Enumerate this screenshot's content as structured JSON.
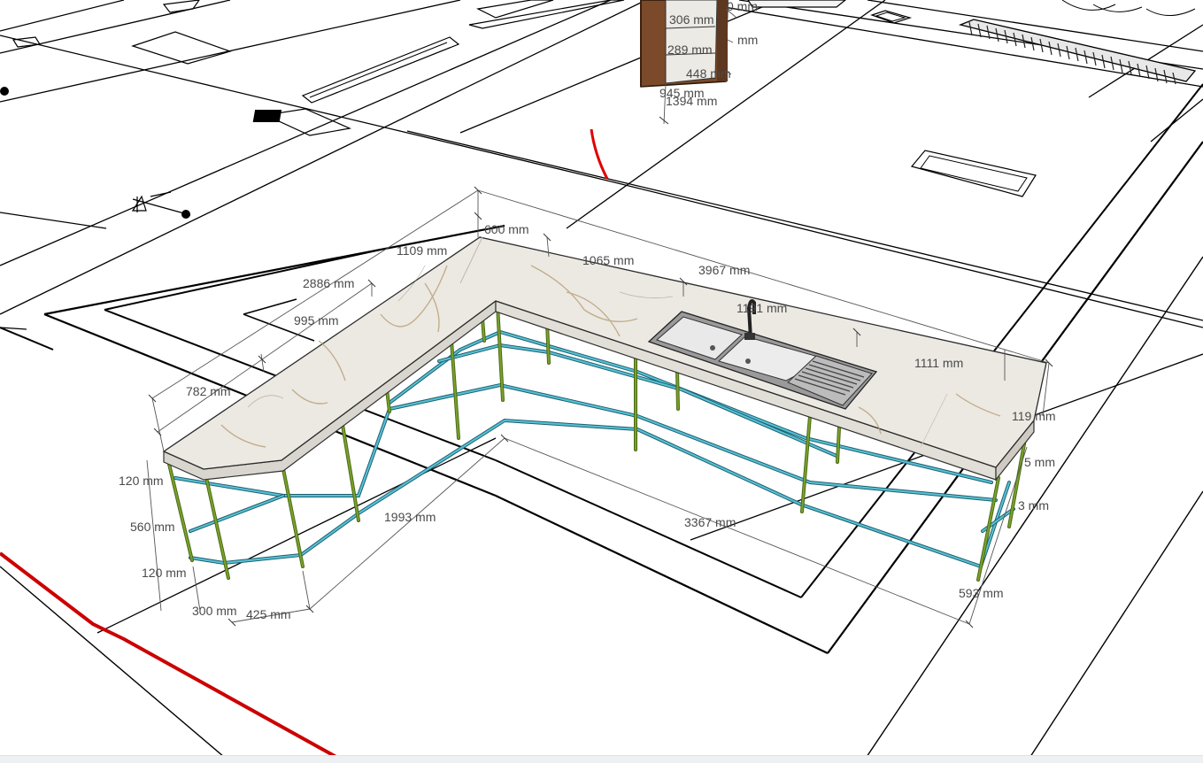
{
  "colors": {
    "background": "#ffffff",
    "plan_lines": "#000000",
    "red_axis": "#cc0000",
    "frame_green": "#4b6a16",
    "frame_cyan": "#56c2d6",
    "marble": "#ece9e3",
    "wood": "#7a4a2a"
  },
  "dimensions": {
    "d600": "600 mm",
    "d1109": "1109 mm",
    "d1065": "1065 mm",
    "d3967": "3967 mm",
    "d2886": "2886 mm",
    "d995": "995 mm",
    "d1191": "1191 mm",
    "d782": "782 mm",
    "d1111": "1111 mm",
    "d119": "119 mm",
    "d120a": "120 mm",
    "d560": "560 mm",
    "d120b": "120 mm",
    "d1993": "1993 mm",
    "d3367": "3367 mm",
    "d300": "300 mm",
    "d425": "425 mm",
    "d593": "593 mm",
    "d5xx": "5 mm",
    "d3xx": "3 mm"
  },
  "cabinet_dimensions": {
    "c306": "306 mm",
    "c0": "0 mm",
    "c289": "289 mm",
    "cmm": "mm",
    "c448": "448 mm",
    "c945": "945 mm",
    "c1394": "1394 mm"
  },
  "icons": {
    "faucet": "faucet-icon",
    "sink": "sink-icon",
    "drain": "drain-grate-icon",
    "person": "section-marker-icon"
  }
}
